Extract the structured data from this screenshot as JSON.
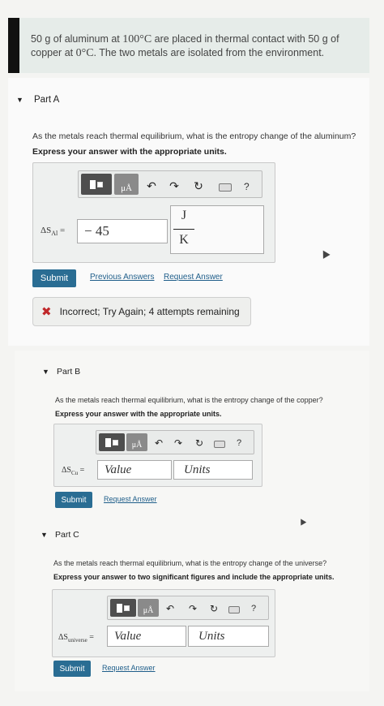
{
  "problem": {
    "line1_a": "50 g of aluminum at ",
    "line1_temp": "100°C",
    "line1_b": " are placed in thermal contact with 50 g of",
    "line2_a": "copper at ",
    "line2_temp": "0°C",
    "line2_b": ". The two metals are isolated from the environment."
  },
  "part_a": {
    "label": "Part A",
    "question": "As the metals reach thermal equilibrium, what is the entropy change of the aluminum?",
    "instruction": "Express your answer with the appropriate units.",
    "var_label": "ΔS",
    "var_sub": "Al",
    "value": "− 45",
    "units_num": "J",
    "units_den": "K",
    "submit": "Submit",
    "prev_answers": "Previous Answers",
    "request_answer": "Request Answer",
    "feedback": "Incorrect; Try Again; 4 attempts remaining"
  },
  "part_b": {
    "label": "Part B",
    "question": "As the metals reach thermal equilibrium, what is the entropy change of the copper?",
    "instruction": "Express your answer with the appropriate units.",
    "var_label": "ΔS",
    "var_sub": "Cu",
    "value_placeholder": "Value",
    "units_placeholder": "Units",
    "submit": "Submit",
    "request_answer": "Request Answer"
  },
  "part_c": {
    "label": "Part C",
    "question": "As the metals reach thermal equilibrium, what is the entropy change of the universe?",
    "instruction": "Express your answer to two significant figures and include the appropriate units.",
    "var_label": "ΔS",
    "var_sub": "universe",
    "value_placeholder": "Value",
    "units_placeholder": "Units",
    "submit": "Submit",
    "request_answer": "Request Answer"
  },
  "toolbar": {
    "mu_label": "μÅ",
    "help": "?",
    "undo": "↶",
    "redo": "↷",
    "reset": "↻"
  },
  "colors": {
    "submit": "#2a6d93",
    "link": "#1f5e8a",
    "incorrect": "#c0282a"
  }
}
